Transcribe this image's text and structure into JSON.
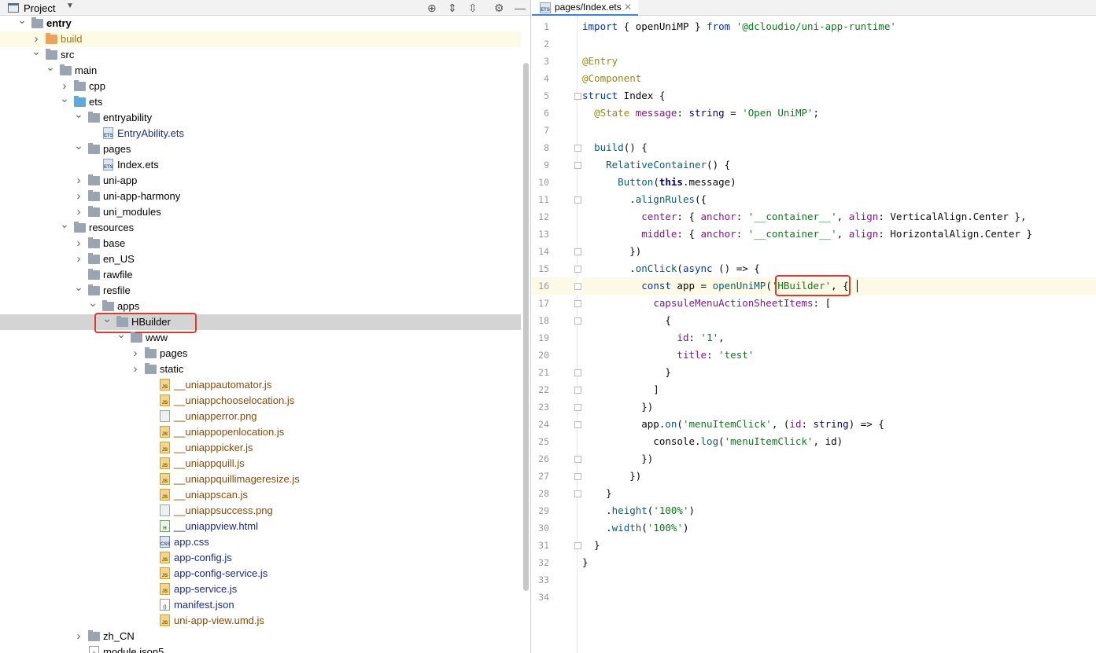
{
  "project_panel": {
    "title": "Project",
    "tree": [
      {
        "label": "entry",
        "depth": 0,
        "arrow": "down",
        "icon": "module",
        "style": "bold"
      },
      {
        "label": "build",
        "depth": 1,
        "arrow": "right",
        "icon": "folder-orange",
        "color": "orange",
        "hl": "build"
      },
      {
        "label": "src",
        "depth": 1,
        "arrow": "down",
        "icon": "folder"
      },
      {
        "label": "main",
        "depth": 2,
        "arrow": "down",
        "icon": "folder"
      },
      {
        "label": "cpp",
        "depth": 3,
        "arrow": "right",
        "icon": "folder"
      },
      {
        "label": "ets",
        "depth": 3,
        "arrow": "down",
        "icon": "folder-blue"
      },
      {
        "label": "entryability",
        "depth": 4,
        "arrow": "down",
        "icon": "folder"
      },
      {
        "label": "EntryAbility.ets",
        "depth": 5,
        "arrow": "",
        "icon": "ets",
        "color": "navy"
      },
      {
        "label": "pages",
        "depth": 4,
        "arrow": "down",
        "icon": "folder"
      },
      {
        "label": "Index.ets",
        "depth": 5,
        "arrow": "",
        "icon": "ets"
      },
      {
        "label": "uni-app",
        "depth": 4,
        "arrow": "right",
        "icon": "folder"
      },
      {
        "label": "uni-app-harmony",
        "depth": 4,
        "arrow": "right",
        "icon": "folder"
      },
      {
        "label": "uni_modules",
        "depth": 4,
        "arrow": "right",
        "icon": "folder"
      },
      {
        "label": "resources",
        "depth": 3,
        "arrow": "down",
        "icon": "folder"
      },
      {
        "label": "base",
        "depth": 4,
        "arrow": "right",
        "icon": "folder"
      },
      {
        "label": "en_US",
        "depth": 4,
        "arrow": "right",
        "icon": "folder"
      },
      {
        "label": "rawfile",
        "depth": 4,
        "arrow": "",
        "icon": "folder"
      },
      {
        "label": "resfile",
        "depth": 4,
        "arrow": "down",
        "icon": "folder"
      },
      {
        "label": "apps",
        "depth": 5,
        "arrow": "down",
        "icon": "folder"
      },
      {
        "label": "HBuilder",
        "depth": 6,
        "arrow": "down",
        "icon": "folder",
        "hl": "sel"
      },
      {
        "label": "www",
        "depth": 7,
        "arrow": "down",
        "icon": "folder"
      },
      {
        "label": "pages",
        "depth": 8,
        "arrow": "right",
        "icon": "folder"
      },
      {
        "label": "static",
        "depth": 8,
        "arrow": "right",
        "icon": "folder"
      },
      {
        "label": "__uniappautomator.js",
        "depth": 9,
        "arrow": "",
        "icon": "js",
        "color": "brown"
      },
      {
        "label": "__uniappchooselocation.js",
        "depth": 9,
        "arrow": "",
        "icon": "js",
        "color": "brown"
      },
      {
        "label": "__uniapperror.png",
        "depth": 9,
        "arrow": "",
        "icon": "png",
        "color": "brown"
      },
      {
        "label": "__uniappopenlocation.js",
        "depth": 9,
        "arrow": "",
        "icon": "js",
        "color": "brown"
      },
      {
        "label": "__uniapppicker.js",
        "depth": 9,
        "arrow": "",
        "icon": "js",
        "color": "brown"
      },
      {
        "label": "__uniappquill.js",
        "depth": 9,
        "arrow": "",
        "icon": "js",
        "color": "brown"
      },
      {
        "label": "__uniappquillimageresize.js",
        "depth": 9,
        "arrow": "",
        "icon": "js",
        "color": "brown"
      },
      {
        "label": "__uniappscan.js",
        "depth": 9,
        "arrow": "",
        "icon": "js",
        "color": "brown"
      },
      {
        "label": "__uniappsuccess.png",
        "depth": 9,
        "arrow": "",
        "icon": "png",
        "color": "brown"
      },
      {
        "label": "__uniappview.html",
        "depth": 9,
        "arrow": "",
        "icon": "html",
        "color": "navy"
      },
      {
        "label": "app.css",
        "depth": 9,
        "arrow": "",
        "icon": "css",
        "color": "navy"
      },
      {
        "label": "app-config.js",
        "depth": 9,
        "arrow": "",
        "icon": "js",
        "color": "navy"
      },
      {
        "label": "app-config-service.js",
        "depth": 9,
        "arrow": "",
        "icon": "js",
        "color": "navy"
      },
      {
        "label": "app-service.js",
        "depth": 9,
        "arrow": "",
        "icon": "js",
        "color": "navy"
      },
      {
        "label": "manifest.json",
        "depth": 9,
        "arrow": "",
        "icon": "json",
        "color": "navy"
      },
      {
        "label": "uni-app-view.umd.js",
        "depth": 9,
        "arrow": "",
        "icon": "js",
        "color": "brown"
      },
      {
        "label": "zh_CN",
        "depth": 4,
        "arrow": "right",
        "icon": "folder"
      },
      {
        "label": "module.json5",
        "depth": 4,
        "arrow": "",
        "icon": "json"
      }
    ]
  },
  "editor": {
    "tab_label": "pages/Index.ets",
    "tab_icon_text": "ETS",
    "lines": [
      "import { openUniMP } from '@dcloudio/uni-app-runtime'",
      "",
      "@Entry",
      "@Component",
      "struct Index {",
      "  @State message: string = 'Open UniMP';",
      "",
      "  build() {",
      "    RelativeContainer() {",
      "      Button(this.message)",
      "        .alignRules({",
      "          center: { anchor: '__container__', align: VerticalAlign.Center },",
      "          middle: { anchor: '__container__', align: HorizontalAlign.Center }",
      "        })",
      "        .onClick(async () => {",
      "          const app = openUniMP('HBuilder', {",
      "            capsuleMenuActionSheetItems: [",
      "              {",
      "                id: '1',",
      "                title: 'test'",
      "              }",
      "            ]",
      "          })",
      "          app.on('menuItemClick', (id: string) => {",
      "            console.log('menuItemClick', id)",
      "          })",
      "        })",
      "    }",
      "    .height('100%')",
      "    .width('100%')",
      "  }",
      "}",
      "",
      ""
    ],
    "current_line": 16
  }
}
